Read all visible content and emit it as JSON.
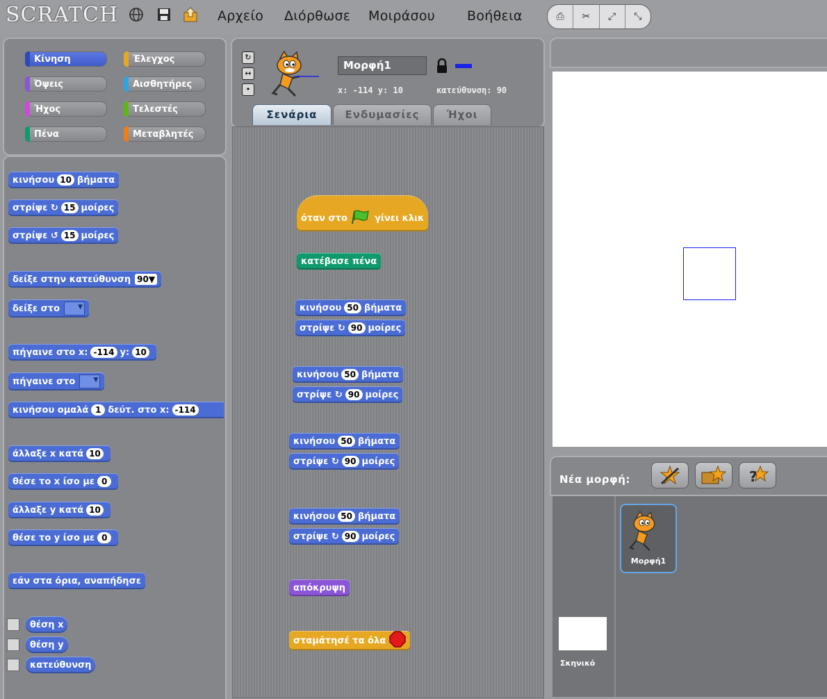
{
  "logo": "SCRATCH",
  "menu": [
    "Αρχείο",
    "Διόρθωσε",
    "Μοιράσου",
    "Βοήθεια"
  ],
  "categories": [
    {
      "label": "Κίνηση",
      "color": "#4a6cd4",
      "selected": true
    },
    {
      "label": "Έλεγχος",
      "color": "#e6a822"
    },
    {
      "label": "Όψεις",
      "color": "#8a55d7"
    },
    {
      "label": "Αισθητήρες",
      "color": "#2ca5e2"
    },
    {
      "label": "Ήχος",
      "color": "#cf4ad9"
    },
    {
      "label": "Τελεστές",
      "color": "#5cb712"
    },
    {
      "label": "Πένα",
      "color": "#0e9a6c"
    },
    {
      "label": "Μεταβλητές",
      "color": "#ee7d16"
    }
  ],
  "palette": {
    "move": [
      "κινήσου",
      "10",
      "βήματα"
    ],
    "turn_cw": [
      "στρίψε",
      "15",
      "μοίρες"
    ],
    "turn_ccw": [
      "στρίψε",
      "15",
      "μοίρες"
    ],
    "point_dir": [
      "δείξε στην κατεύθυνση",
      "90"
    ],
    "point_towards": "δείξε στο",
    "goto_xy": [
      "πήγαινε στο x:",
      "-114",
      "y:",
      "10"
    ],
    "goto": "πήγαινε στο",
    "glide": [
      "κινήσου ομαλά",
      "1",
      "δεύτ. στο x:",
      "-114"
    ],
    "change_x": [
      "άλλαξε x κατά",
      "10"
    ],
    "set_x": [
      "θέσε το x ίσο με",
      "0"
    ],
    "change_y": [
      "άλλαξε y κατά",
      "10"
    ],
    "set_y": [
      "θέσε το y ίσο με",
      "0"
    ],
    "bounce": "εάν στα όρια, αναπήδησε",
    "reporters": [
      "θέση x",
      "θέση y",
      "κατεύθυνση"
    ]
  },
  "sprite": {
    "name": "Μορφή1",
    "coords": "x: -114  y: 10",
    "direction": "κατεύθυνση: 90",
    "pen_color": "#1a22e6"
  },
  "tabs": [
    "Σενάρια",
    "Ενδυμασίες",
    "Ήχοι"
  ],
  "script": {
    "hat": [
      "όταν στο",
      "γίνει κλικ"
    ],
    "pen_down": "κατέβασε πένα",
    "move_label": "κινήσου",
    "move_val": "50",
    "move_unit": "βήματα",
    "turn_label": "στρίψε",
    "turn_val": "90",
    "turn_unit": "μοίρες",
    "hide": "απόκρυψη",
    "stop": "σταμάτησέ τα όλα"
  },
  "new_sprite_label": "Νέα μορφή:",
  "sprite_thumb_label": "Μορφή1",
  "stage_label": "Σκηνικό"
}
